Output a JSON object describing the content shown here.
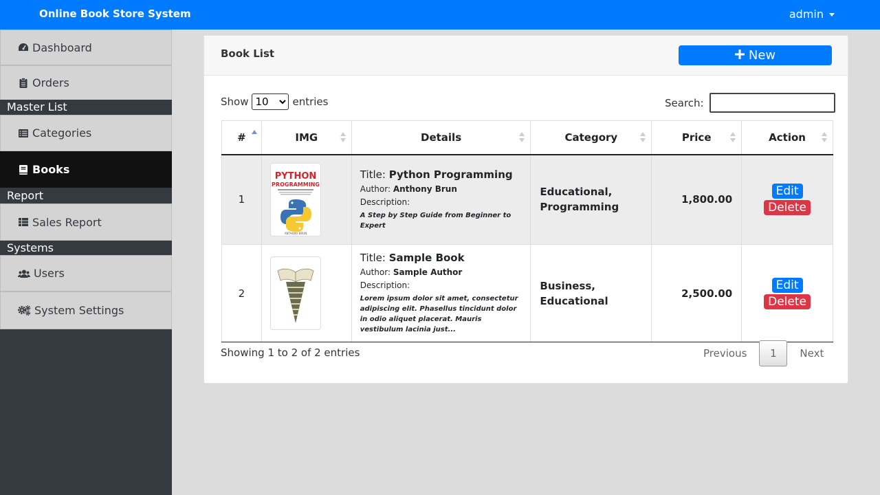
{
  "app": {
    "brand": "Online Book Store System",
    "user": "admin"
  },
  "sidebar": {
    "items": [
      {
        "label": "Dashboard"
      },
      {
        "label": "Orders"
      },
      {
        "label": "Categories"
      },
      {
        "label": "Books"
      },
      {
        "label": "Sales Report"
      },
      {
        "label": "Users"
      },
      {
        "label": "System Settings"
      }
    ],
    "headers": [
      "Master List",
      "Report",
      "Systems"
    ]
  },
  "card": {
    "title": "Book List",
    "new_label": "New"
  },
  "controls": {
    "show": "Show",
    "entries_value": "10",
    "entries": "entries",
    "search_label": "Search:",
    "search_value": ""
  },
  "table": {
    "headers": [
      "#",
      "IMG",
      "Details",
      "Category",
      "Price",
      "Action"
    ],
    "rows": [
      {
        "num": "1",
        "title_label": "Title:",
        "title": "Python Programming",
        "author_label": "Author:",
        "author": "Anthony Brun",
        "desc_label": "Description:",
        "desc": "A Step by Step Guide from Beginner to Expert",
        "category": "Educational, Programming",
        "price": "1,800.00",
        "cover": {
          "line1": "PYTHON",
          "line2": "PROGRAMMING",
          "author": "ANTHONY BRUN"
        }
      },
      {
        "num": "2",
        "title_label": "Title:",
        "title": "Sample Book",
        "author_label": "Author:",
        "author": "Sample Author",
        "desc_label": "Description:",
        "desc": "Lorem ipsum dolor sit amet, consectetur adipiscing elit. Phasellus tincidunt dolor in odio aliquet placerat. Mauris vestibulum lacinia just...",
        "category": "Business, Educational",
        "price": "2,500.00"
      }
    ],
    "edit_label": "Edit",
    "delete_label": "Delete"
  },
  "footer": {
    "info": "Showing 1 to 2 of 2 entries",
    "previous": "Previous",
    "page": "1",
    "next": "Next"
  },
  "colors": {
    "primary": "#007bff",
    "danger": "#dc3545",
    "sidebar_dark": "#343a40",
    "active": "#111111"
  },
  "icons": [
    "tachometer-icon",
    "clipboard-icon",
    "list-icon",
    "book-icon",
    "table-icon",
    "users-icon",
    "cogs-icon",
    "plus-icon",
    "caret-down-icon"
  ]
}
